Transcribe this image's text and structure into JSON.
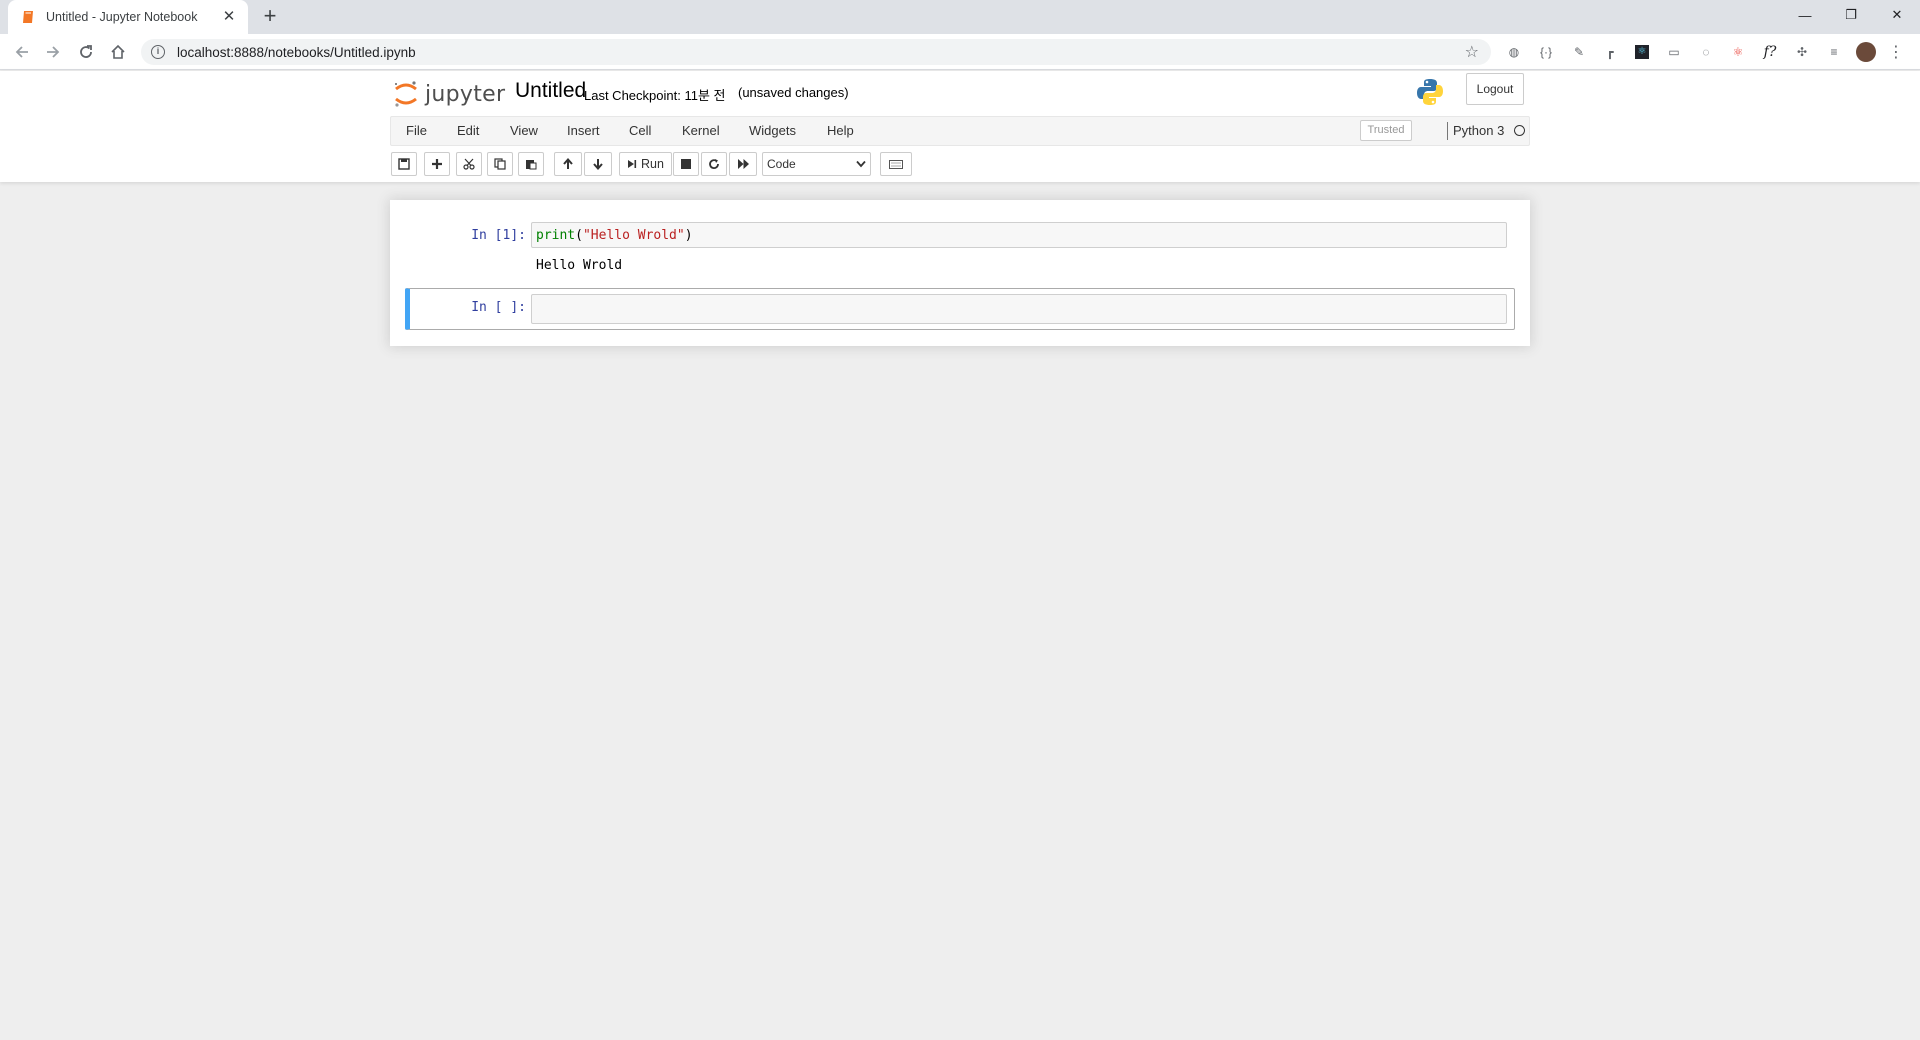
{
  "browser": {
    "tab_title": "Untitled - Jupyter Notebook",
    "tab_close": "✕",
    "new_tab": "+",
    "url": "localhost:8888/notebooks/Untitled.ipynb",
    "window_controls": {
      "minimize": "—",
      "restore": "❐",
      "close": "✕"
    }
  },
  "header": {
    "logo_text": "jupyter",
    "notebook_name": "Untitled",
    "checkpoint": "Last Checkpoint: 11분 전",
    "autosave_status": "(unsaved changes)",
    "logout_label": "Logout"
  },
  "menubar": {
    "items": [
      "File",
      "Edit",
      "View",
      "Insert",
      "Cell",
      "Kernel",
      "Widgets",
      "Help"
    ],
    "trusted_label": "Trusted",
    "kernel_name": "Python 3"
  },
  "toolbar": {
    "run_label": "Run",
    "cell_type": "Code"
  },
  "cells": [
    {
      "prompt": "In [1]:",
      "code": {
        "fn": "print",
        "open": "(",
        "str": "\"Hello Wrold\"",
        "close": ")"
      },
      "output": "Hello Wrold"
    },
    {
      "prompt": "In [ ]:",
      "selected": true
    }
  ],
  "colors": {
    "accent_orange": "#f37726",
    "selected_border": "#42a5f5",
    "prompt_blue": "#303f9f",
    "code_green": "#008000",
    "string_red": "#ba2121"
  }
}
